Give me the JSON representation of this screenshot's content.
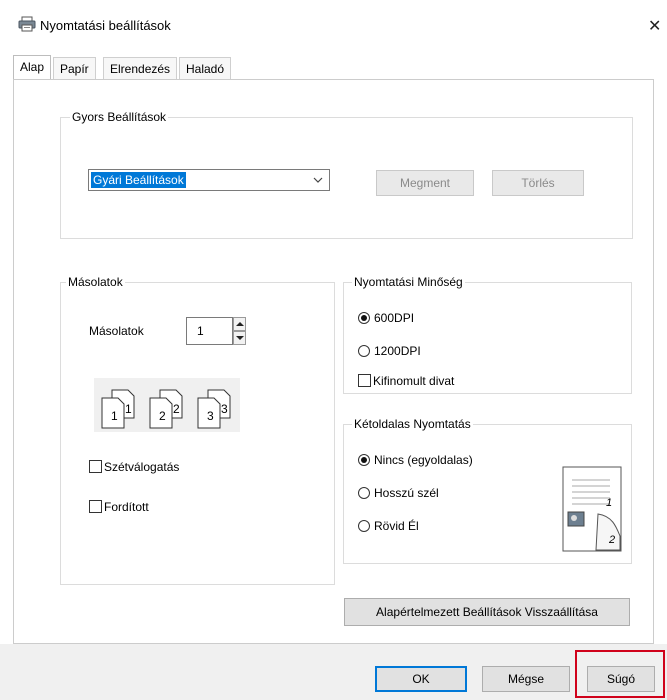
{
  "window": {
    "title": "Nyomtatási beállítások",
    "close_glyph": "✕"
  },
  "tabs": [
    {
      "label": "Alap",
      "active": true
    },
    {
      "label": "Papír"
    },
    {
      "label": "Elrendezés"
    },
    {
      "label": "Haladó"
    }
  ],
  "quick_settings": {
    "legend": "Gyors Beállítások",
    "selected": "Gyári Beállítások",
    "save_label": "Megment",
    "delete_label": "Törlés"
  },
  "copies": {
    "legend": "Másolatok",
    "label": "Másolatok",
    "value": "1",
    "page_icons": [
      "1",
      "2",
      "3"
    ],
    "collate_label": "Szétválogatás",
    "collate_checked": false,
    "reverse_label": "Fordított",
    "reverse_checked": false
  },
  "quality": {
    "legend": "Nyomtatási Minőség",
    "options": [
      "600DPI",
      "1200DPI"
    ],
    "selected": "600DPI",
    "fine_mode_label": "Kifinomult divat",
    "fine_mode_checked": false
  },
  "duplex": {
    "legend": "Kétoldalas Nyomtatás",
    "options": [
      "Nincs (egyoldalas)",
      "Hosszú szél",
      "Rövid Él"
    ],
    "selected": "Nincs (egyoldalas)",
    "preview_numbers": [
      "1",
      "2"
    ]
  },
  "restore_defaults_label": "Alapértelmezett Beállítások Visszaállítása",
  "footer": {
    "ok_label": "OK",
    "cancel_label": "Mégse",
    "help_label": "Súgó"
  },
  "colors": {
    "selection_blue": "#0078d7",
    "highlight_red": "#d0021b"
  }
}
